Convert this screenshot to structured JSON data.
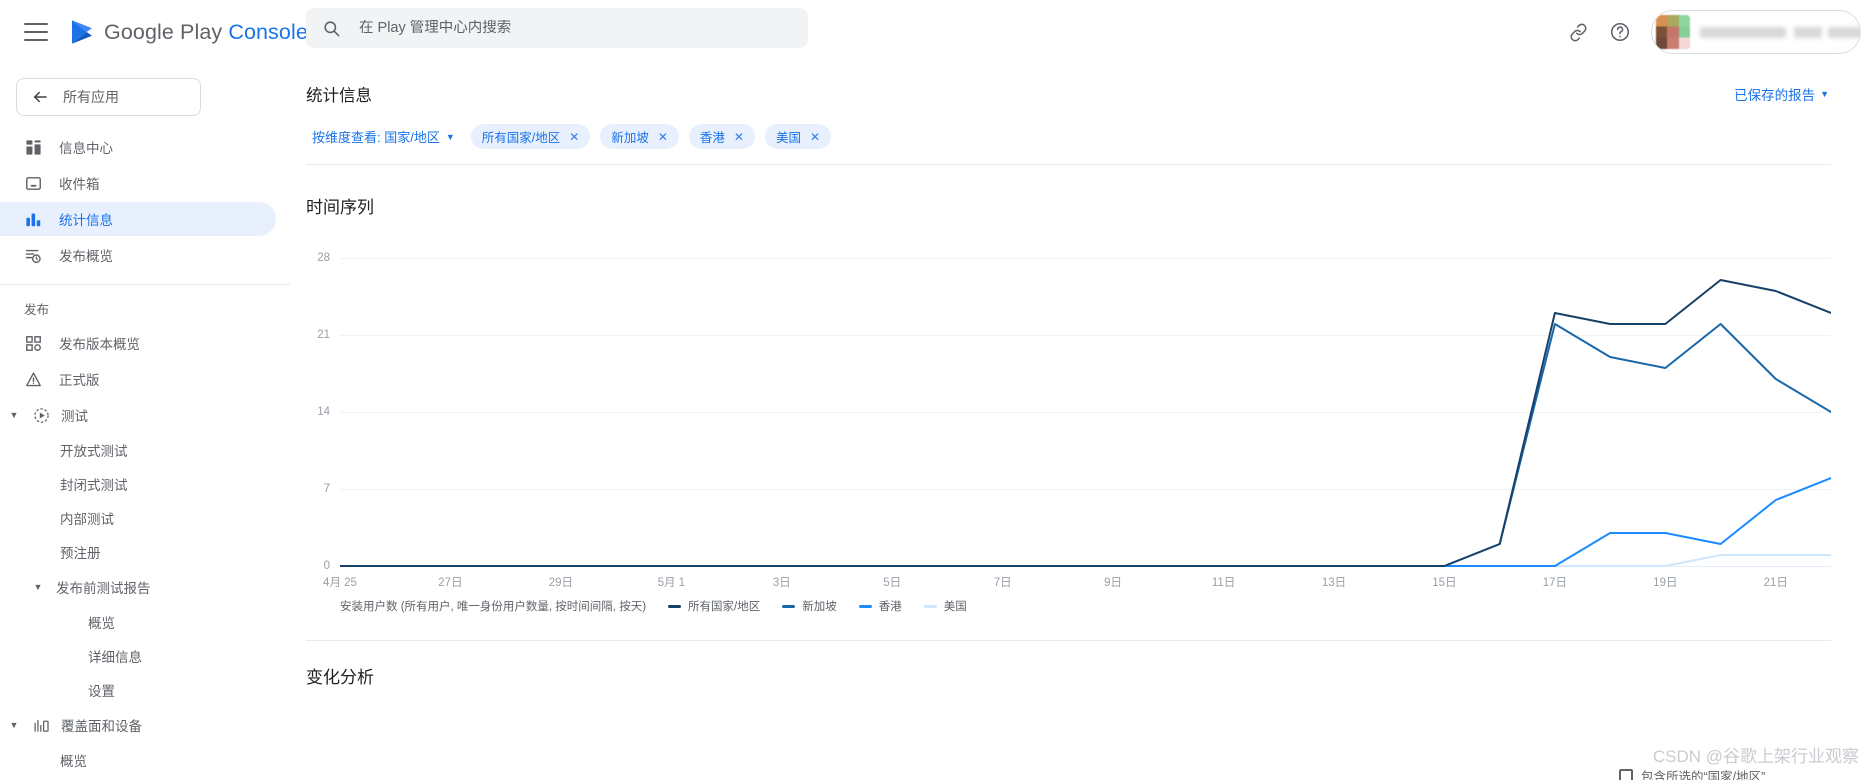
{
  "topbar": {
    "menu_icon": "hamburger-menu-icon",
    "brand_part1": "Google Play ",
    "brand_part2": "Console",
    "search_placeholder": "在 Play 管理中心内搜索",
    "search_value": "",
    "search_icon": "search-icon",
    "link_icon": "link-icon",
    "help_icon": "help-circle-icon",
    "account_name": ""
  },
  "sidebar": {
    "back_label": "所有应用",
    "items": [
      {
        "label": "信息中心",
        "icon": "dashboard-icon",
        "active": false
      },
      {
        "label": "收件箱",
        "icon": "inbox-icon",
        "active": false
      },
      {
        "label": "统计信息",
        "icon": "bar-chart-icon",
        "active": true
      },
      {
        "label": "发布概览",
        "icon": "release-overview-icon",
        "active": false
      }
    ],
    "section_title": "发布",
    "release_items": [
      {
        "label": "发布版本概览",
        "icon": "releases-grid-icon",
        "level": 0,
        "expandable": false
      },
      {
        "label": "正式版",
        "icon": "production-icon",
        "level": 0,
        "expandable": false
      },
      {
        "label": "测试",
        "icon": "testing-icon",
        "level": 0,
        "expandable": true,
        "expanded": true
      },
      {
        "label": "开放式测试",
        "icon": "",
        "level": 1,
        "expandable": false
      },
      {
        "label": "封闭式测试",
        "icon": "",
        "level": 1,
        "expandable": false
      },
      {
        "label": "内部测试",
        "icon": "",
        "level": 1,
        "expandable": false
      },
      {
        "label": "预注册",
        "icon": "",
        "level": 1,
        "expandable": false
      },
      {
        "label": "发布前测试报告",
        "icon": "",
        "level": 1,
        "expandable": true,
        "expanded": true
      },
      {
        "label": "概览",
        "icon": "",
        "level": 2,
        "expandable": false
      },
      {
        "label": "详细信息",
        "icon": "",
        "level": 2,
        "expandable": false
      },
      {
        "label": "设置",
        "icon": "",
        "level": 2,
        "expandable": false
      },
      {
        "label": "覆盖面和设备",
        "icon": "reach-devices-icon",
        "level": 0,
        "expandable": true,
        "expanded": true
      },
      {
        "label": "概览",
        "icon": "",
        "level": 1,
        "expandable": false
      }
    ]
  },
  "page": {
    "title": "统计信息",
    "saved_reports_label": "已保存的报告",
    "saved_reports_caret": "caret-down-icon"
  },
  "filters": {
    "dimension_label": "按维度查看: 国家/地区",
    "dimension_caret": "caret-down-icon",
    "chips": [
      {
        "label": "所有国家/地区",
        "remove": "×"
      },
      {
        "label": "新加坡",
        "remove": "×"
      },
      {
        "label": "香港",
        "remove": "×"
      },
      {
        "label": "美国",
        "remove": "×"
      }
    ]
  },
  "next_section": {
    "title": "变化分析"
  },
  "subcheck": {
    "label": "包含所选的“国家/地区”"
  },
  "watermark": {
    "text": "CSDN @谷歌上架行业观察"
  },
  "chart_data": {
    "type": "line",
    "title": "时间序列",
    "xlabel": "",
    "ylabel": "",
    "ylim": [
      0,
      30
    ],
    "yticks": [
      28,
      21,
      14,
      7,
      0
    ],
    "grid": true,
    "legend_position": "bottom",
    "metric_label": "安装用户数 (所有用户, 唯一身份用户数量, 按时间间隔, 按天)",
    "x": [
      "4月 25",
      "4月 26",
      "27日",
      "28日",
      "29日",
      "30日",
      "5月 1",
      "5月 2",
      "3日",
      "4日",
      "5日",
      "6日",
      "7日",
      "8日",
      "9日",
      "10日",
      "11日",
      "12日",
      "13日",
      "14日",
      "15日",
      "16日",
      "17日",
      "18日",
      "19日",
      "20日",
      "21日",
      "22日"
    ],
    "xticks": [
      "4月 25",
      "27日",
      "29日",
      "5月 1",
      "3日",
      "5日",
      "7日",
      "9日",
      "11日",
      "13日",
      "15日",
      "17日",
      "19日",
      "21日"
    ],
    "series": [
      {
        "name": "所有国家/地区",
        "color": "#174168",
        "values": [
          0,
          0,
          0,
          0,
          0,
          0,
          0,
          0,
          0,
          0,
          0,
          0,
          0,
          0,
          0,
          0,
          0,
          0,
          0,
          0,
          0,
          2,
          23,
          22,
          22,
          26,
          25,
          23
        ]
      },
      {
        "name": "新加坡",
        "color": "#1967a8",
        "values": [
          0,
          0,
          0,
          0,
          0,
          0,
          0,
          0,
          0,
          0,
          0,
          0,
          0,
          0,
          0,
          0,
          0,
          0,
          0,
          0,
          0,
          2,
          22,
          19,
          18,
          22,
          17,
          14
        ]
      },
      {
        "name": "香港",
        "color": "#1a8cff",
        "values": [
          0,
          0,
          0,
          0,
          0,
          0,
          0,
          0,
          0,
          0,
          0,
          0,
          0,
          0,
          0,
          0,
          0,
          0,
          0,
          0,
          0,
          0,
          0,
          3,
          3,
          2,
          6,
          8
        ]
      },
      {
        "name": "美国",
        "color": "#cfe6fb",
        "values": [
          0,
          0,
          0,
          0,
          0,
          0,
          0,
          0,
          0,
          0,
          0,
          0,
          0,
          0,
          0,
          0,
          0,
          0,
          0,
          0,
          0,
          0,
          0,
          0,
          0,
          1,
          1,
          1
        ]
      }
    ]
  }
}
